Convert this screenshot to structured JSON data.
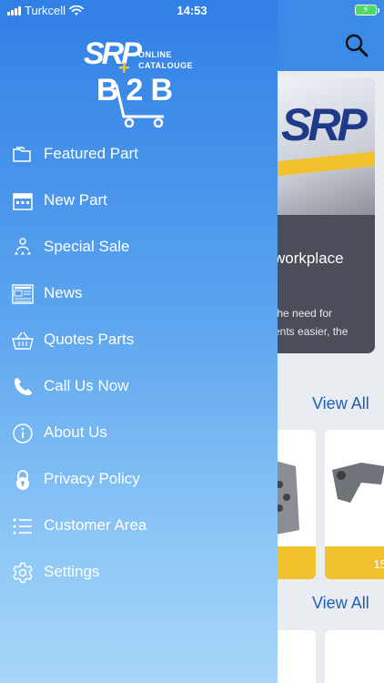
{
  "status_bar": {
    "carrier": "Turkcell",
    "time": "14:53"
  },
  "logo": {
    "brand": "SRP",
    "online": "ONLINE",
    "catalogue": "CATALOUGE",
    "b2b": "B2B"
  },
  "menu": {
    "items": [
      {
        "label": "Featured Part",
        "icon": "folder-icon"
      },
      {
        "label": "New Part",
        "icon": "calendar-icon"
      },
      {
        "label": "Special Sale",
        "icon": "podium-icon"
      },
      {
        "label": "News",
        "icon": "newspaper-icon"
      },
      {
        "label": "Quotes Parts",
        "icon": "basket-icon"
      },
      {
        "label": "Call Us Now",
        "icon": "phone-icon"
      },
      {
        "label": "About Us",
        "icon": "info-icon"
      },
      {
        "label": "Privacy Policy",
        "icon": "lock-icon"
      },
      {
        "label": "Customer Area",
        "icon": "list-icon"
      },
      {
        "label": "Settings",
        "icon": "gear-icon"
      }
    ]
  },
  "background": {
    "banner_brand": "SRP",
    "banner_title": "workplace",
    "banner_text_line1": "the need for",
    "banner_text_line2": "ents easier, the",
    "view_all_1": "View All",
    "view_all_2": "View All",
    "card_price": "15"
  },
  "colors": {
    "drawer_top": "#2f7fe6",
    "drawer_bottom": "#a6d6f8",
    "accent": "#f2c12e",
    "link": "#1d5fb6"
  }
}
